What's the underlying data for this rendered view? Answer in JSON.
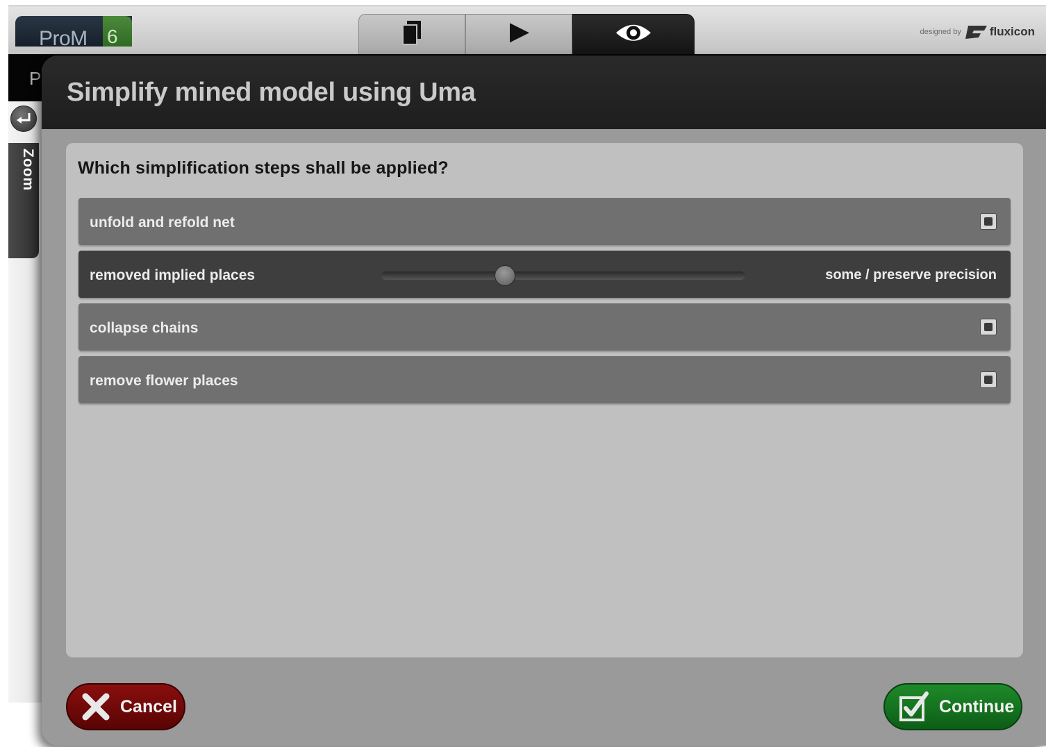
{
  "app": {
    "logo_text": "ProM",
    "logo_version": "6",
    "brand_prefix": "designed by",
    "brand_name": "fluxicon",
    "tabs": [
      {
        "icon": "workspace-icon",
        "active": false
      },
      {
        "icon": "play-icon",
        "active": false
      },
      {
        "icon": "eye-icon",
        "active": true
      }
    ]
  },
  "background": {
    "title_fragment": "P",
    "zoom_label": "Zoom"
  },
  "dialog": {
    "title": "Simplify mined model using Uma",
    "question": "Which simplification steps shall be applied?",
    "options": [
      {
        "label": "unfold and refold net",
        "type": "checkbox",
        "checked": false
      },
      {
        "label": "removed implied places",
        "type": "slider",
        "value_label": "some / preserve precision",
        "slider_fraction": 0.34
      },
      {
        "label": "collapse chains",
        "type": "checkbox",
        "checked": false
      },
      {
        "label": "remove flower places",
        "type": "checkbox",
        "checked": false
      }
    ],
    "cancel_label": "Cancel",
    "continue_label": "Continue"
  },
  "colors": {
    "cancel": "#7a0a0a",
    "continue": "#157a22",
    "header": "#222222"
  }
}
